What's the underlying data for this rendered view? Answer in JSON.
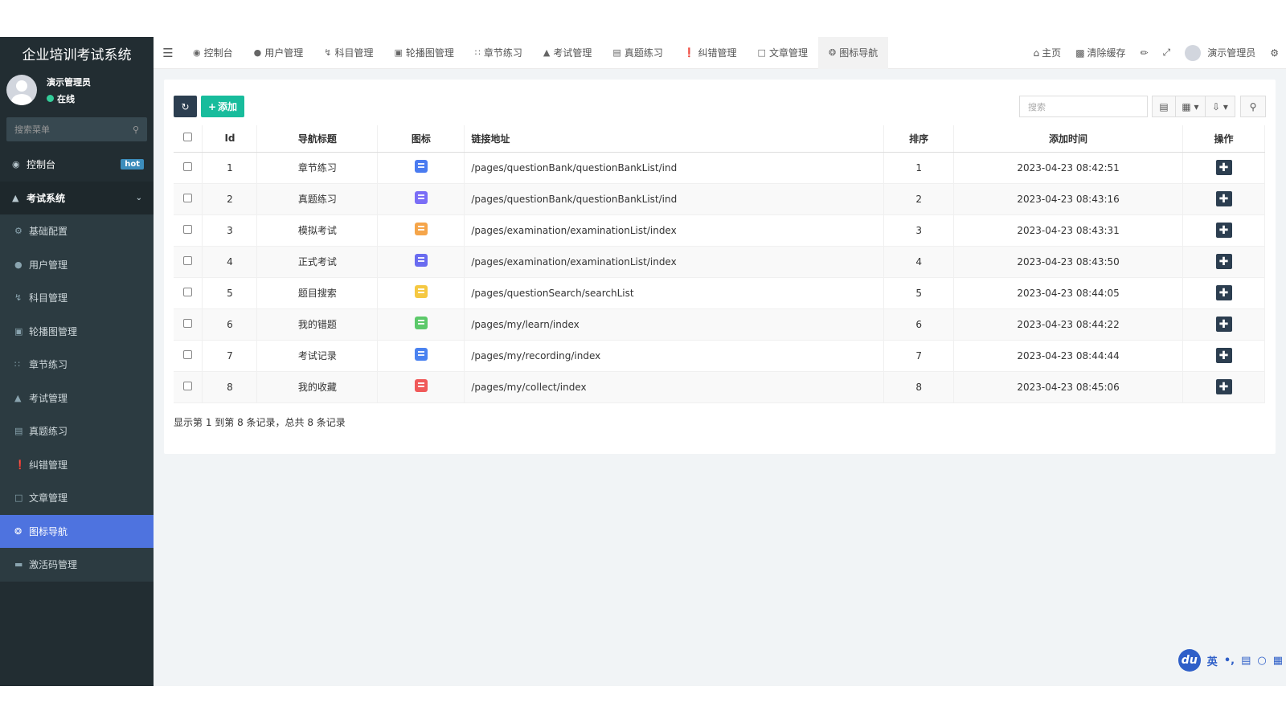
{
  "brand": "企业培训考试系统",
  "user": {
    "name": "演示管理员",
    "status": "在线"
  },
  "sidebar": {
    "search_placeholder": "搜索菜单",
    "items": [
      {
        "label": "控制台",
        "icon": "dashboard-icon",
        "badge": "hot"
      },
      {
        "label": "考试系统",
        "icon": "graduation-cap-icon"
      },
      {
        "label": "基础配置",
        "icon": "gear-icon"
      },
      {
        "label": "用户管理",
        "icon": "user-icon"
      },
      {
        "label": "科目管理",
        "icon": "bolt-icon"
      },
      {
        "label": "轮播图管理",
        "icon": "image-icon"
      },
      {
        "label": "章节练习",
        "icon": "grid-icon"
      },
      {
        "label": "考试管理",
        "icon": "graduation-cap-icon"
      },
      {
        "label": "真题练习",
        "icon": "list-icon"
      },
      {
        "label": "纠错管理",
        "icon": "alert-icon"
      },
      {
        "label": "文章管理",
        "icon": "file-icon"
      },
      {
        "label": "图标导航",
        "icon": "compass-icon"
      },
      {
        "label": "激活码管理",
        "icon": "credit-card-icon"
      }
    ]
  },
  "topnav": {
    "tabs": [
      {
        "label": "控制台",
        "icon": "dashboard-icon"
      },
      {
        "label": "用户管理",
        "icon": "user-icon"
      },
      {
        "label": "科目管理",
        "icon": "bolt-icon"
      },
      {
        "label": "轮播图管理",
        "icon": "image-icon"
      },
      {
        "label": "章节练习",
        "icon": "grid-icon"
      },
      {
        "label": "考试管理",
        "icon": "graduation-cap-icon"
      },
      {
        "label": "真题练习",
        "icon": "list-icon"
      },
      {
        "label": "纠错管理",
        "icon": "alert-icon"
      },
      {
        "label": "文章管理",
        "icon": "file-icon"
      },
      {
        "label": "图标导航",
        "icon": "compass-icon"
      }
    ],
    "home": "主页",
    "clear_cache": "清除缓存",
    "admin": "演示管理员"
  },
  "toolbar": {
    "add_label": "添加",
    "search_placeholder": "搜索"
  },
  "table": {
    "headers": [
      "Id",
      "导航标题",
      "图标",
      "链接地址",
      "排序",
      "添加时间",
      "操作"
    ],
    "rows": [
      {
        "id": "1",
        "title": "章节练习",
        "icon_color": "#4a7bf0",
        "link": "/pages/questionBank/questionBankList/ind",
        "sort": "1",
        "time": "2023-04-23 08:42:51"
      },
      {
        "id": "2",
        "title": "真题练习",
        "icon_color": "#7b6ef6",
        "link": "/pages/questionBank/questionBankList/ind",
        "sort": "2",
        "time": "2023-04-23 08:43:16"
      },
      {
        "id": "3",
        "title": "模拟考试",
        "icon_color": "#f5a54a",
        "link": "/pages/examination/examinationList/index",
        "sort": "3",
        "time": "2023-04-23 08:43:31"
      },
      {
        "id": "4",
        "title": "正式考试",
        "icon_color": "#6a6cf0",
        "link": "/pages/examination/examinationList/index",
        "sort": "4",
        "time": "2023-04-23 08:43:50"
      },
      {
        "id": "5",
        "title": "题目搜索",
        "icon_color": "#f5c842",
        "link": "/pages/questionSearch/searchList",
        "sort": "5",
        "time": "2023-04-23 08:44:05"
      },
      {
        "id": "6",
        "title": "我的错题",
        "icon_color": "#5cc96a",
        "link": "/pages/my/learn/index",
        "sort": "6",
        "time": "2023-04-23 08:44:22"
      },
      {
        "id": "7",
        "title": "考试记录",
        "icon_color": "#4a82f0",
        "link": "/pages/my/recording/index",
        "sort": "7",
        "time": "2023-04-23 08:44:44"
      },
      {
        "id": "8",
        "title": "我的收藏",
        "icon_color": "#f05a5a",
        "link": "/pages/my/collect/index",
        "sort": "8",
        "time": "2023-04-23 08:45:06"
      }
    ]
  },
  "pager": "显示第 1 到第 8 条记录，总共 8 条记录",
  "ime": {
    "logo": "du",
    "lang": "英"
  }
}
